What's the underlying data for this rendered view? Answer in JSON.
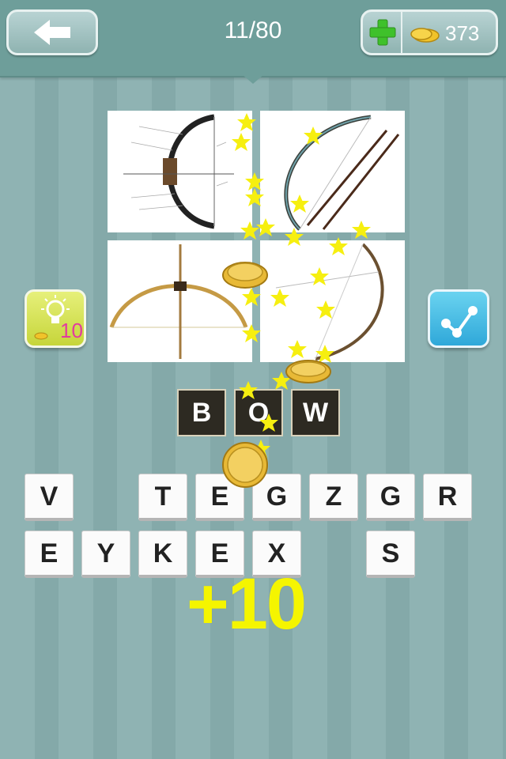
{
  "header": {
    "level": "11/80",
    "coins": "373"
  },
  "hint": {
    "cost": "10"
  },
  "answer": [
    "B",
    "O",
    "W"
  ],
  "keyboard": {
    "row1": [
      "V",
      "",
      "T",
      "E",
      "G",
      "Z",
      "G",
      "R"
    ],
    "row2": [
      "E",
      "Y",
      "K",
      "E",
      "X",
      "",
      "S",
      ""
    ]
  },
  "reward": "+10",
  "colors": {
    "accent_yellow": "#f5f500",
    "hint_cost": "#e23aa0",
    "answer_tile": "#2d2a22"
  },
  "icons": [
    "back-arrow-icon",
    "plus-icon",
    "coin-icon",
    "lightbulb-icon",
    "share-icon",
    "star-icon"
  ]
}
